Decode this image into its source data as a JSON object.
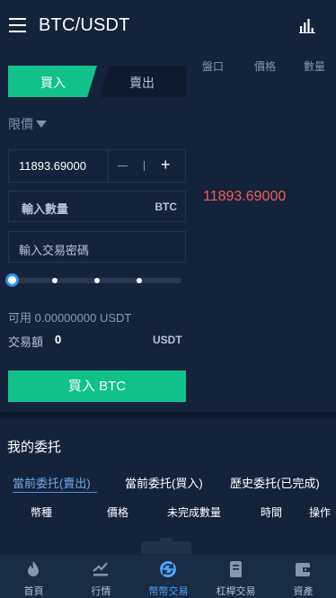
{
  "header": {
    "title": "BTC/USDT",
    "menu_icon": "hamburger-menu-icon",
    "chart_icon": "bar-chart-icon"
  },
  "trade": {
    "buy_tab": "買入",
    "sell_tab": "賣出",
    "order_type": "限價",
    "price_value": "11893.69000",
    "minus": "－",
    "plus": "+",
    "qty_placeholder": "輸入數量",
    "qty_unit": "BTC",
    "password_placeholder": "輸入交易密碼",
    "slider_percent": 0,
    "available_label": "可用",
    "available_value": "0.00000000",
    "available_unit": "USDT",
    "amount_label": "交易額",
    "amount_value": "0",
    "amount_unit": "USDT",
    "buy_button": "買入 BTC",
    "buy_color": "#10c28a",
    "sell_color": "#ee5d5d"
  },
  "order_book": {
    "headers": [
      "盤口",
      "價格",
      "數量"
    ],
    "current_price": "11893.69000"
  },
  "orders": {
    "title": "我的委托",
    "tabs": [
      "當前委托(賣出)",
      "當前委托(買入)",
      "歷史委托(已完成)"
    ],
    "active_tab": 0,
    "columns": [
      "幣種",
      "價格",
      "未完成數量",
      "時間",
      "操作"
    ]
  },
  "bottom_nav": {
    "items": [
      {
        "label": "首頁",
        "icon": "flame-icon"
      },
      {
        "label": "行情",
        "icon": "trend-chart-icon"
      },
      {
        "label": "幣幣交易",
        "icon": "exchange-refresh-icon"
      },
      {
        "label": "杠桿交易",
        "icon": "document-icon"
      },
      {
        "label": "資產",
        "icon": "wallet-icon"
      }
    ],
    "active_index": 2,
    "active_color": "#4ca3f7"
  }
}
